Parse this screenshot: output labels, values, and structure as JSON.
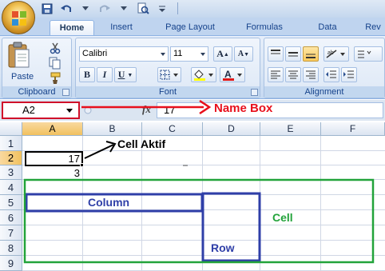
{
  "quick_access": {
    "icons": [
      "save-icon",
      "undo-icon",
      "redo-icon",
      "print-preview-icon",
      "customize-icon"
    ]
  },
  "tabs": [
    {
      "label": "Home",
      "active": true
    },
    {
      "label": "Insert",
      "active": false
    },
    {
      "label": "Page Layout",
      "active": false
    },
    {
      "label": "Formulas",
      "active": false
    },
    {
      "label": "Data",
      "active": false
    },
    {
      "label": "Rev",
      "active": false
    }
  ],
  "ribbon": {
    "clipboard": {
      "group_label": "Clipboard",
      "paste_label": "Paste"
    },
    "font": {
      "group_label": "Font",
      "font_name": "Calibri",
      "font_size": "11",
      "bold": "B",
      "italic": "I",
      "underline": "U",
      "grow": "A",
      "shrink": "A"
    },
    "alignment": {
      "group_label": "Alignment"
    }
  },
  "formula_bar": {
    "name_box": "A2",
    "fx": "fx",
    "value": "17"
  },
  "sheet": {
    "columns": [
      "A",
      "B",
      "C",
      "D",
      "E",
      "F"
    ],
    "selected_column": "A",
    "rows": [
      "1",
      "2",
      "3",
      "4",
      "5",
      "6",
      "7",
      "8",
      "9"
    ],
    "selected_row": "2",
    "cells": {
      "A2": "17",
      "A3": "3"
    }
  },
  "annotations": {
    "name_box": "Name Box",
    "cell_aktif": "Cell Aktif",
    "column": "Column",
    "row": "Row",
    "cell": "Cell"
  },
  "colors": {
    "name_box_annotation": "#e8101c",
    "column_row_annotation": "#2f3fa8",
    "cell_annotation": "#22a33a",
    "selection": "#000000"
  }
}
